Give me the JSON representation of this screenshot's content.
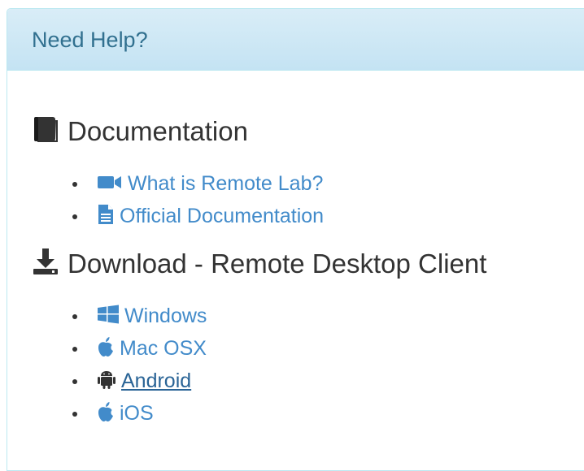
{
  "panel": {
    "title": "Need Help?"
  },
  "documentation": {
    "heading": "Documentation",
    "heading_icon": "book-icon",
    "links": [
      {
        "label": "What is Remote Lab?",
        "icon": "video-camera-icon"
      },
      {
        "label": "Official Documentation",
        "icon": "file-text-icon"
      }
    ]
  },
  "download": {
    "heading": "Download - Remote Desktop Client",
    "heading_icon": "download-icon",
    "links": [
      {
        "label": "Windows",
        "icon": "windows-icon"
      },
      {
        "label": "Mac OSX",
        "icon": "apple-icon"
      },
      {
        "label": "Android",
        "icon": "android-icon"
      },
      {
        "label": "iOS",
        "icon": "apple-icon"
      }
    ]
  },
  "colors": {
    "heading_bg": "#d9edf7",
    "heading_text": "#31708f",
    "panel_border": "#bce8f1",
    "link": "#428bca",
    "link_hover": "#2a6496",
    "text": "#333333"
  }
}
